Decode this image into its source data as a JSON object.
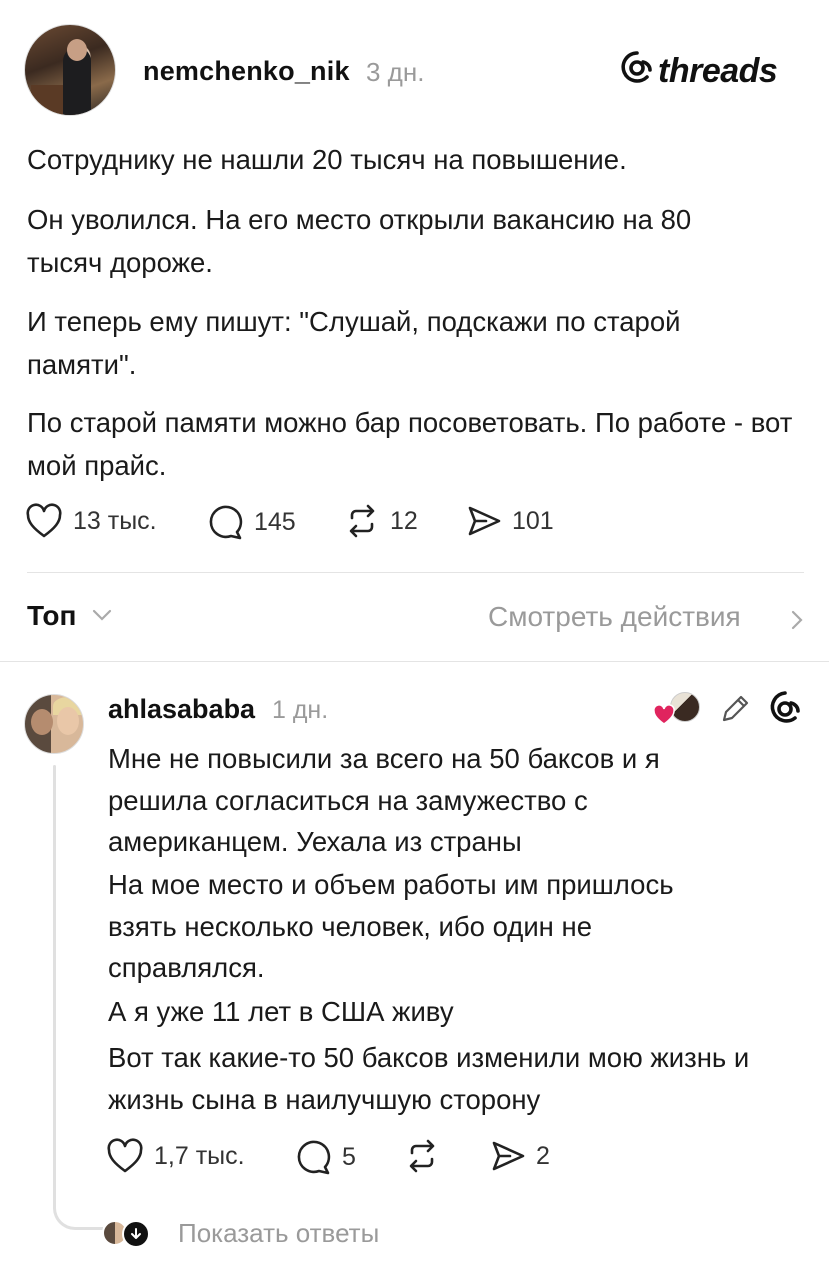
{
  "post": {
    "username": "nemchenko_nik",
    "time": "3 дн.",
    "brand": "threads",
    "paragraphs": [
      "Сотруднику не нашли 20 тысяч на повышение.",
      "Он уволился. На его место открыли вакансию на 80 тысяч дороже.",
      "И теперь ему пишут: \"Слушай, подскажи по старой памяти\".",
      "По старой памяти можно бар посоветовать. По работе - вот мой прайс."
    ],
    "stats": {
      "likes": "13 тыс.",
      "comments": "145",
      "reposts": "12",
      "shares": "101"
    }
  },
  "sort": {
    "label": "Топ",
    "view_actions": "Смотреть действия"
  },
  "reply": {
    "username": "ahlasababa",
    "time": "1 дн.",
    "paragraphs": [
      "Мне не повысили за всего на 50 баксов и я решила согласиться на замужество с американцем. Уехала из страны",
      "На мое место и объем работы им пришлось взять несколько человек, ибо один не справлялся.",
      "А я уже 11 лет в США живу",
      "Вот так какие-то 50 баксов изменили мою жизнь и жизнь сына в наилучшую сторону"
    ],
    "stats": {
      "likes": "1,7 тыс.",
      "comments": "5",
      "shares": "2"
    },
    "show_replies": "Показать ответы"
  },
  "icons": {
    "like": "heart-icon",
    "comment": "comment-bubble-icon",
    "repost": "repost-icon",
    "share": "send-icon",
    "brand": "threads-at-icon",
    "edit": "pencil-icon",
    "liked_by": "liked-by-author-icon"
  }
}
